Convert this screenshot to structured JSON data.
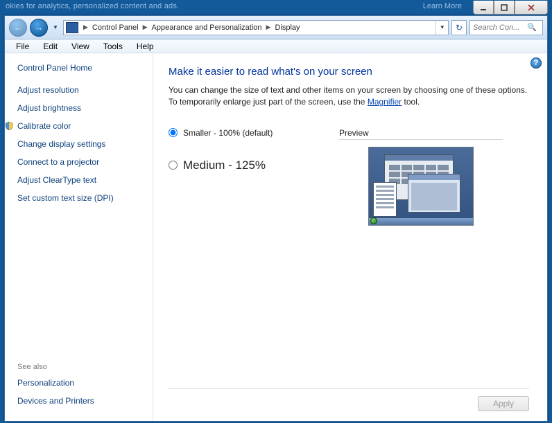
{
  "window": {
    "minimize_tooltip": "Minimize",
    "maximize_tooltip": "Maximize",
    "close_tooltip": "Close"
  },
  "breadcrumb": {
    "segments": [
      "Control Panel",
      "Appearance and Personalization",
      "Display"
    ]
  },
  "search": {
    "placeholder": "Search Con..."
  },
  "menu": {
    "file": "File",
    "edit": "Edit",
    "view": "View",
    "tools": "Tools",
    "help": "Help"
  },
  "sidebar": {
    "home": "Control Panel Home",
    "links": [
      {
        "label": "Adjust resolution",
        "shield": false
      },
      {
        "label": "Adjust brightness",
        "shield": false
      },
      {
        "label": "Calibrate color",
        "shield": true
      },
      {
        "label": "Change display settings",
        "shield": false
      },
      {
        "label": "Connect to a projector",
        "shield": false
      },
      {
        "label": "Adjust ClearType text",
        "shield": false
      },
      {
        "label": "Set custom text size (DPI)",
        "shield": false
      }
    ],
    "see_also_heading": "See also",
    "see_also": [
      "Personalization",
      "Devices and Printers"
    ]
  },
  "main": {
    "heading": "Make it easier to read what's on your screen",
    "desc_prefix": "You can change the size of text and other items on your screen by choosing one of these options. To temporarily enlarge just part of the screen, use the ",
    "magnifier_link": "Magnifier",
    "desc_suffix": " tool.",
    "options": [
      {
        "label": "Smaller - 100% (default)",
        "value": "100",
        "checked": true,
        "size": "normal"
      },
      {
        "label": "Medium - 125%",
        "value": "125",
        "checked": false,
        "size": "large"
      }
    ],
    "preview_label": "Preview",
    "apply_label": "Apply"
  },
  "help_tooltip": "Get help"
}
